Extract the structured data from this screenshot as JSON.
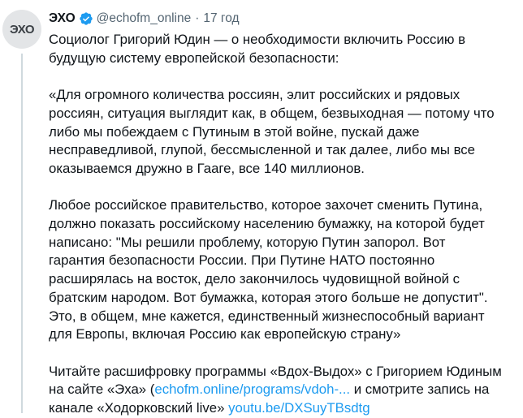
{
  "author": {
    "avatar_text": "ЭХО",
    "display_name": "ЭХО",
    "handle": "@echofm_online",
    "separator": "·",
    "time": "17 год"
  },
  "tweet": {
    "intro": "Социолог Григорий Юдин — о необходимости включить Россию в\nбудущую систему европейской безопасности:",
    "quote_p1": "«Для огромного количества россиян, элит российских и рядовых\nроссиян, ситуация выглядит как, в общем, безвыходная — потому что\nлибо мы побеждаем с Путиным в этой войне, пускай даже\nнесправедливой, глупой, бессмысленной и так далее, либо мы все\nоказываемся дружно в Гааге, все 140 миллионов.",
    "quote_p2": "Любое российское правительство, которое захочет сменить Путина,\nдолжно показать российскому населению бумажку, на которой будет\nнаписано: \"Мы решили проблему, которую Путин запорол. Вот\nгарантия безопасности России. При Путине НАТО постоянно\nрасширялась на восток, дело закончилось чудовищной войной с\nбратским народом. Вот бумажка, которая этого больше не допустит\".\nЭто, в общем, мне кажется, единственный жизнеспособный вариант\nдля Европы, включая Россию как европейскую страну»",
    "outro_line1": "Читайте расшифровку программы «Вдох-Выдох» с Григорием Юдиным",
    "outro_line2_pre": "на сайте «Эха» (",
    "outro_link1": "echofm.online/programs/vdoh-...",
    "outro_line2_post": " и смотрите запись на",
    "outro_line3_pre": "канале «Ходорковский live» ",
    "outro_link2": "youtu.be/DXSuyTBsdtg"
  },
  "colors": {
    "link": "#1d9bf0",
    "verified": "#1d9bf0",
    "secondary_text": "#536471"
  }
}
